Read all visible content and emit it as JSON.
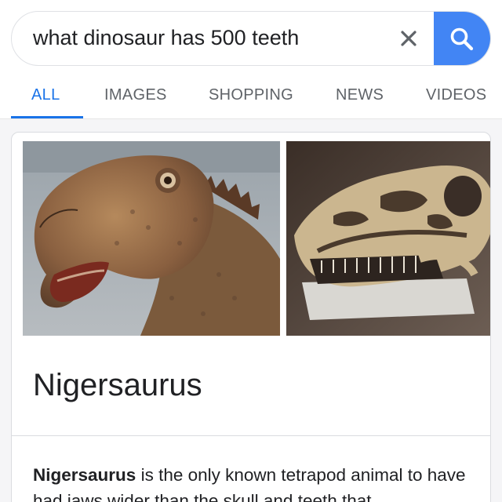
{
  "search": {
    "query": "what dinosaur has 500 teeth",
    "clear_icon": "close-icon",
    "search_icon": "search-icon",
    "accent_color": "#4285f4"
  },
  "tabs": [
    {
      "label": "ALL",
      "active": true
    },
    {
      "label": "IMAGES",
      "active": false
    },
    {
      "label": "SHOPPING",
      "active": false
    },
    {
      "label": "NEWS",
      "active": false
    },
    {
      "label": "VIDEOS",
      "active": false
    }
  ],
  "knowledge_panel": {
    "images": [
      {
        "subject": "Nigersaurus model head"
      },
      {
        "subject": "Nigersaurus skull"
      }
    ],
    "title": "Nigersaurus",
    "snippet_bold": "Nigersaurus",
    "snippet_rest": " is the only known tetrapod animal to have had jaws wider than the skull and teeth that"
  }
}
